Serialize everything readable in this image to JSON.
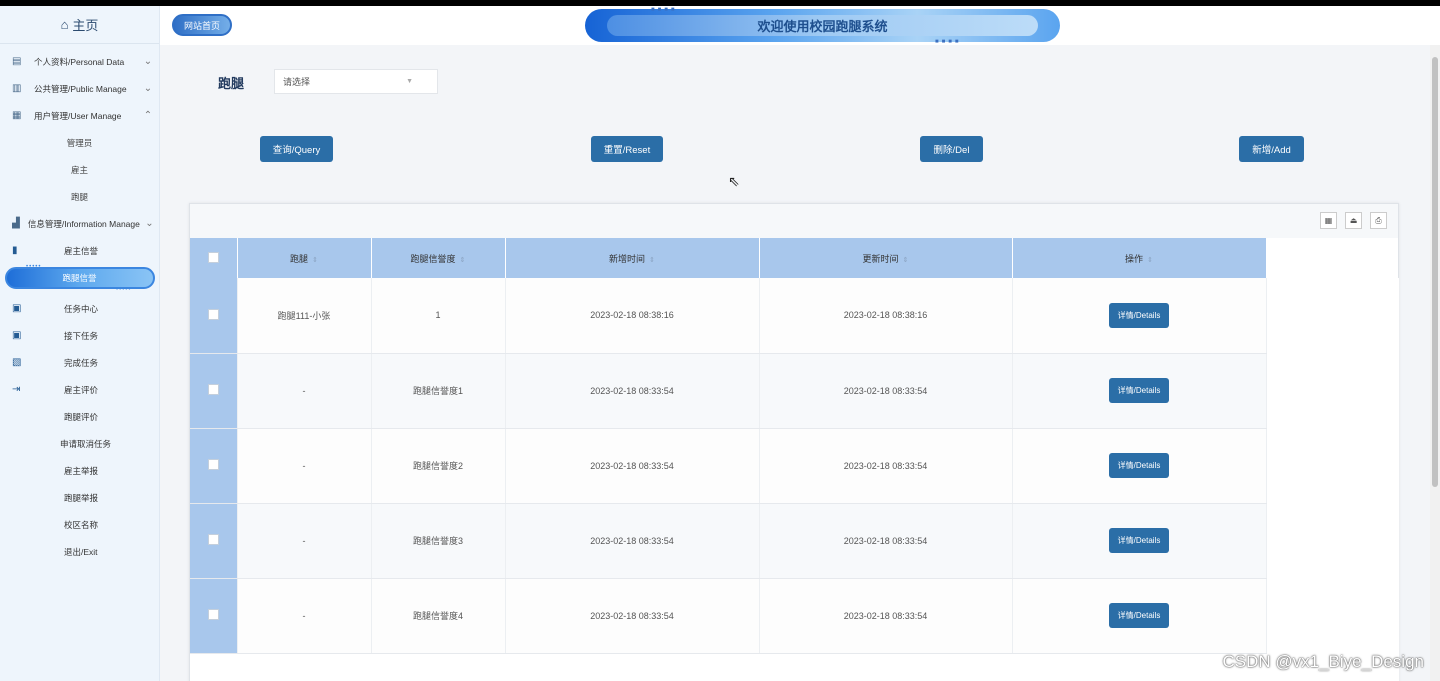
{
  "sidebar": {
    "home_label": "主页",
    "groups": [
      {
        "label": "个人资料/Personal Data",
        "icon": "doc-icon"
      },
      {
        "label": "公共管理/Public Manage",
        "icon": "clipboard-icon"
      },
      {
        "label": "用户管理/User Manage",
        "icon": "users-icon",
        "children": [
          "管理员",
          "雇主",
          "跑腿"
        ]
      },
      {
        "label": "信息管理/Information Manage",
        "icon": "chart-icon"
      }
    ],
    "info_items": [
      {
        "label": "雇主信誉",
        "icon": "bookmark-icon"
      },
      {
        "label": "跑腿信誉",
        "active": true
      },
      {
        "label": "任务中心",
        "icon": "calendar-icon"
      },
      {
        "label": "接下任务",
        "icon": "calendar-check-icon"
      },
      {
        "label": "完成任务",
        "icon": "book-icon"
      },
      {
        "label": "雇主评价",
        "icon": "exit-icon"
      },
      {
        "label": "跑腿评价"
      },
      {
        "label": "申请取消任务"
      },
      {
        "label": "雇主举报"
      },
      {
        "label": "跑腿举报"
      },
      {
        "label": "校区名称"
      },
      {
        "label": "退出/Exit"
      }
    ]
  },
  "header": {
    "site_link": "网站首页",
    "banner_title": "欢迎使用校园跑腿系统"
  },
  "search": {
    "label": "跑腿",
    "select_value": "请选择"
  },
  "actions": {
    "query": "查询/Query",
    "reset": "重置/Reset",
    "delete": "删除/Del",
    "add": "新增/Add"
  },
  "table": {
    "columns": [
      "跑腿",
      "跑腿信誉度",
      "新增时间",
      "更新时间",
      "操作"
    ],
    "rows": [
      {
        "runner": "跑腿111-小张",
        "credit": "1",
        "created": "2023-02-18 08:38:16",
        "updated": "2023-02-18 08:38:16",
        "action": "详情/Details"
      },
      {
        "runner": "-",
        "credit": "跑腿信誉度1",
        "created": "2023-02-18 08:33:54",
        "updated": "2023-02-18 08:33:54",
        "action": "详情/Details"
      },
      {
        "runner": "-",
        "credit": "跑腿信誉度2",
        "created": "2023-02-18 08:33:54",
        "updated": "2023-02-18 08:33:54",
        "action": "详情/Details"
      },
      {
        "runner": "-",
        "credit": "跑腿信誉度3",
        "created": "2023-02-18 08:33:54",
        "updated": "2023-02-18 08:33:54",
        "action": "详情/Details"
      },
      {
        "runner": "-",
        "credit": "跑腿信誉度4",
        "created": "2023-02-18 08:33:54",
        "updated": "2023-02-18 08:33:54",
        "action": "详情/Details"
      }
    ]
  },
  "watermark": "CSDN @vx1_Biye_Design",
  "colors": {
    "primary_button": "#2b6ea7",
    "table_header": "#a8c7ec",
    "sidebar_bg": "#eef5fc"
  }
}
